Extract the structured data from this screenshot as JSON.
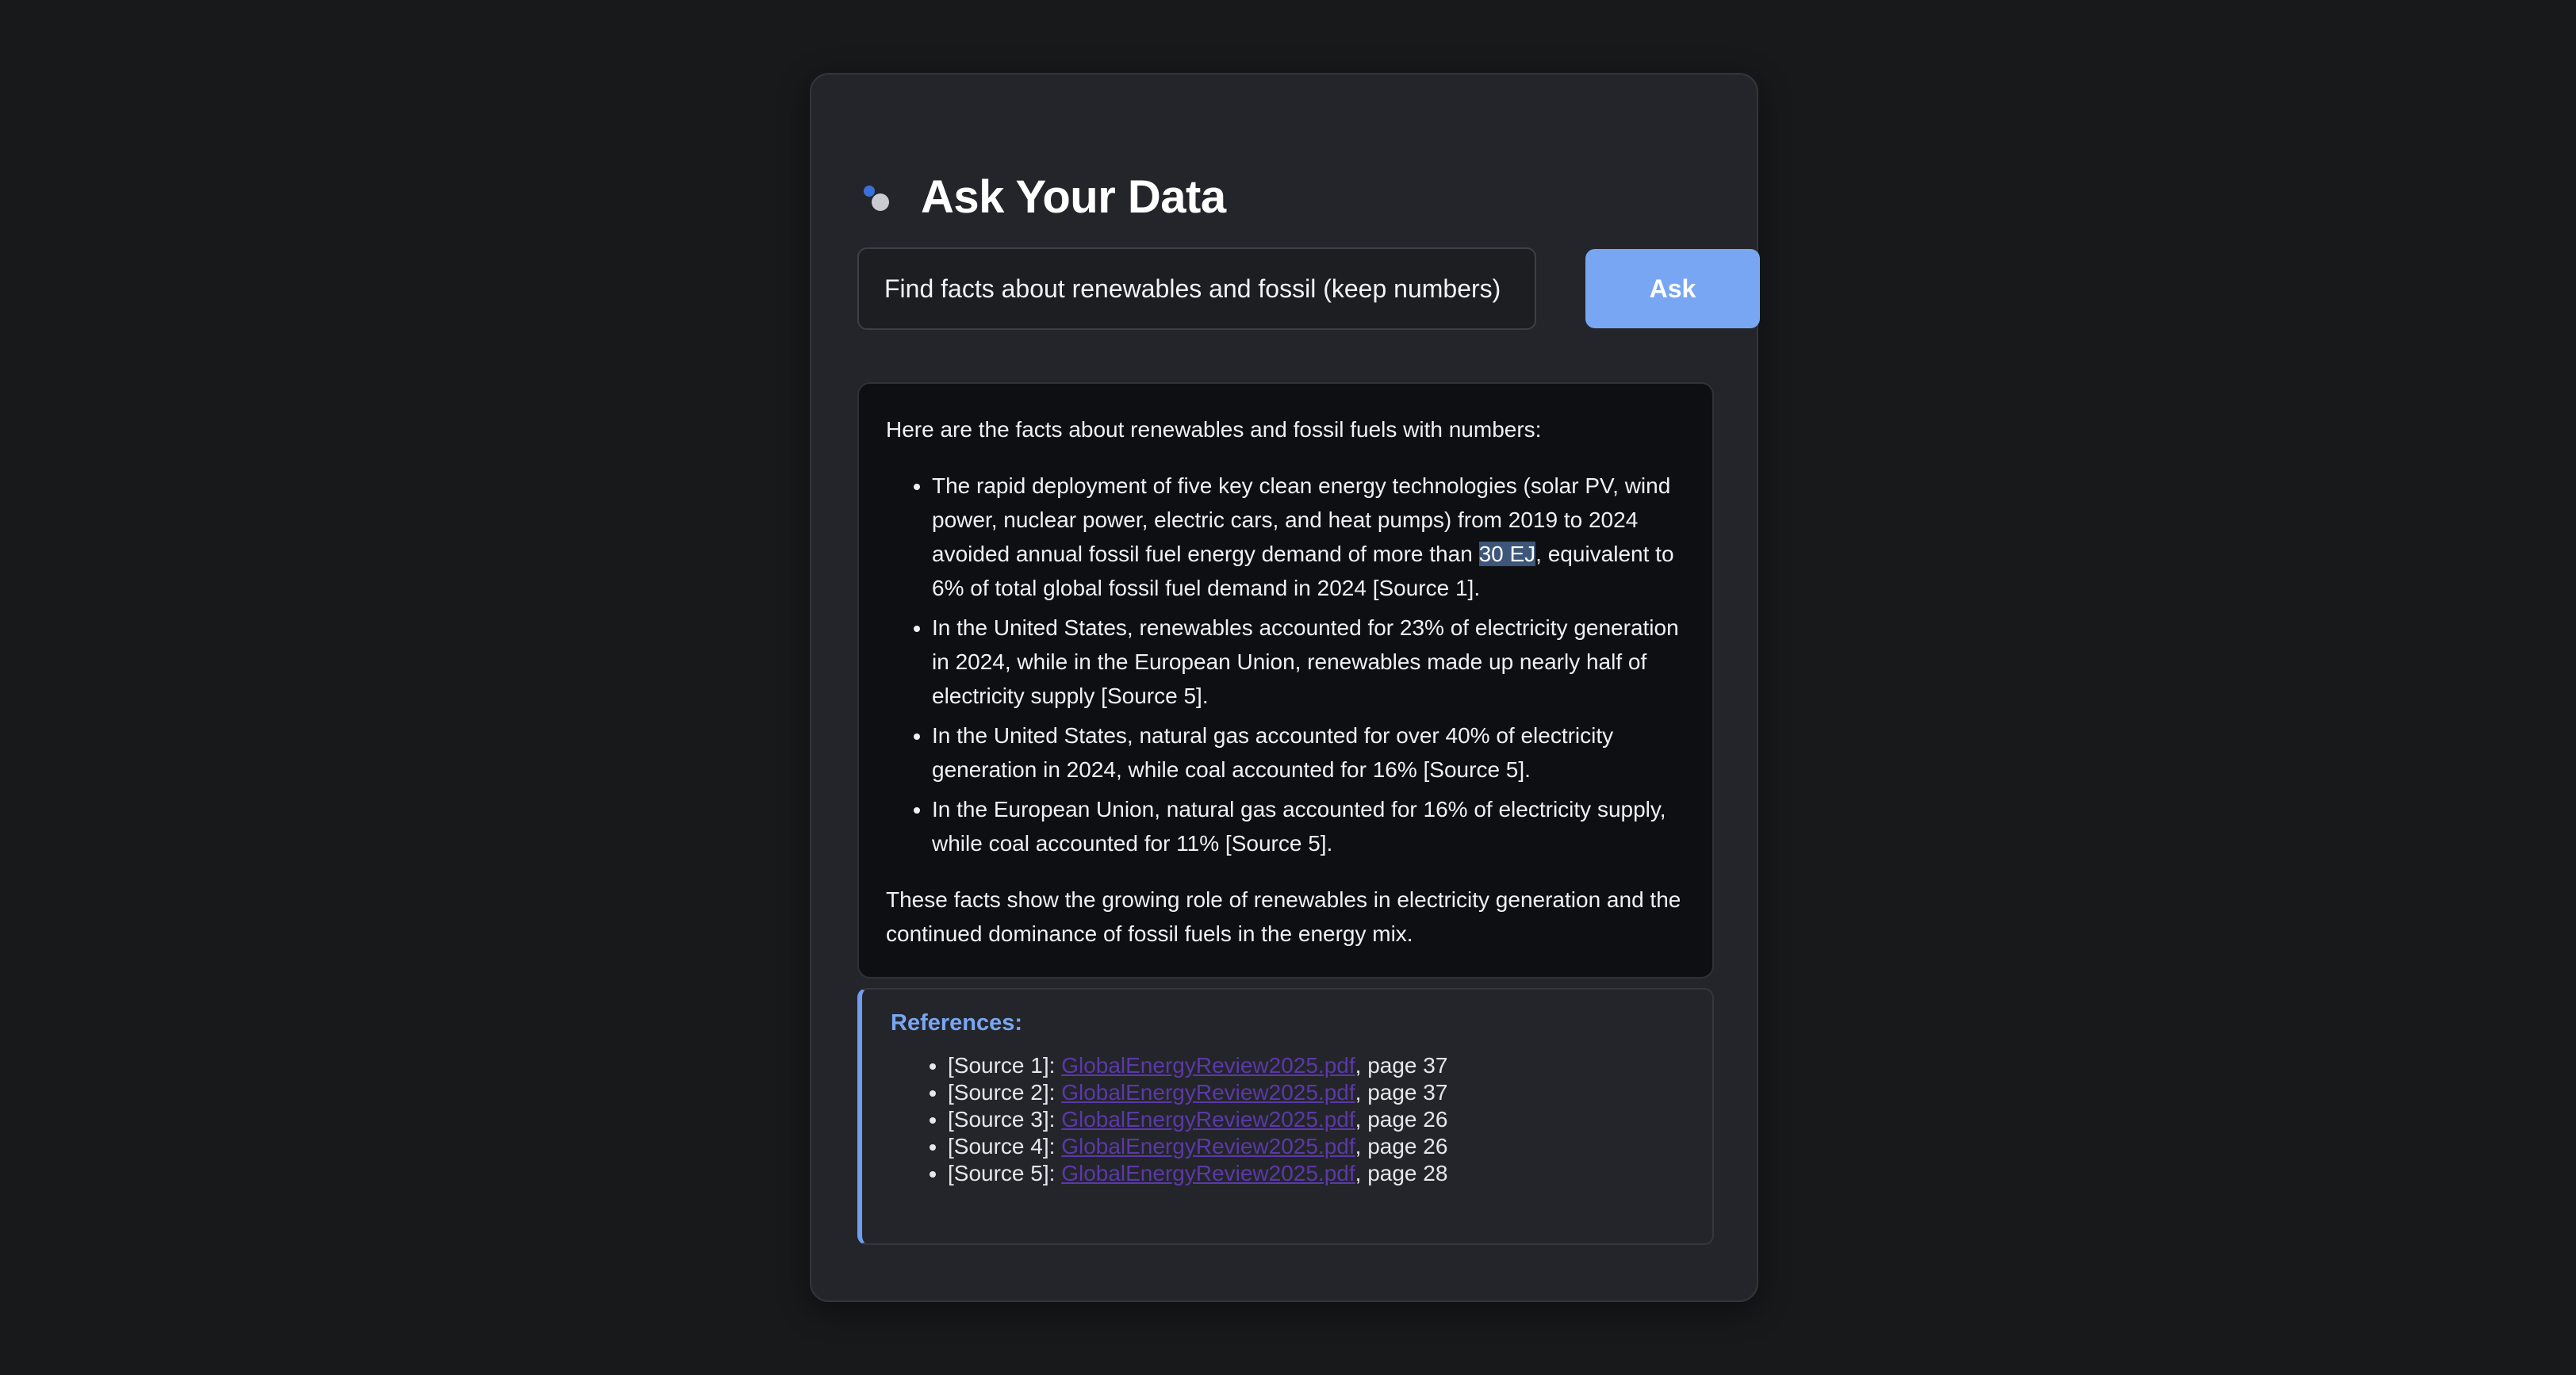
{
  "app": {
    "title": "Ask Your Data"
  },
  "search": {
    "value": "Find facts about renewables and fossil (keep numbers)",
    "button_label": "Ask"
  },
  "answer": {
    "intro": "Here are the facts about renewables and fossil fuels with numbers:",
    "bullets": [
      {
        "before": "The rapid deployment of five key clean energy technologies (solar PV, wind power, nuclear power, electric cars, and heat pumps) from 2019 to 2024 avoided annual fossil fuel energy demand of more than ",
        "highlight": "30 EJ",
        "after": ", equivalent to 6% of total global fossil fuel demand in 2024 [Source 1]."
      },
      {
        "text": "In the United States, renewables accounted for 23% of electricity generation in 2024, while in the European Union, renewables made up nearly half of electricity supply [Source 5]."
      },
      {
        "text": "In the United States, natural gas accounted for over 40% of electricity generation in 2024, while coal accounted for 16% [Source 5]."
      },
      {
        "text": "In the European Union, natural gas accounted for 16% of electricity supply, while coal accounted for 11% [Source 5]."
      }
    ],
    "conclusion": "These facts show the growing role of renewables in electricity generation and the continued dominance of fossil fuels in the energy mix."
  },
  "references": {
    "title": "References:",
    "items": [
      {
        "label": "[Source 1]: ",
        "file": "GlobalEnergyReview2025.pdf",
        "page": ", page 37"
      },
      {
        "label": "[Source 2]: ",
        "file": "GlobalEnergyReview2025.pdf",
        "page": ", page 37"
      },
      {
        "label": "[Source 3]: ",
        "file": "GlobalEnergyReview2025.pdf",
        "page": ", page 26"
      },
      {
        "label": "[Source 4]: ",
        "file": "GlobalEnergyReview2025.pdf",
        "page": ", page 26"
      },
      {
        "label": "[Source 5]: ",
        "file": "GlobalEnergyReview2025.pdf",
        "page": ", page 28"
      }
    ]
  },
  "colors": {
    "accent": "#79a6f3",
    "link_visited": "#5b39a8",
    "highlight": "#3d5679"
  }
}
